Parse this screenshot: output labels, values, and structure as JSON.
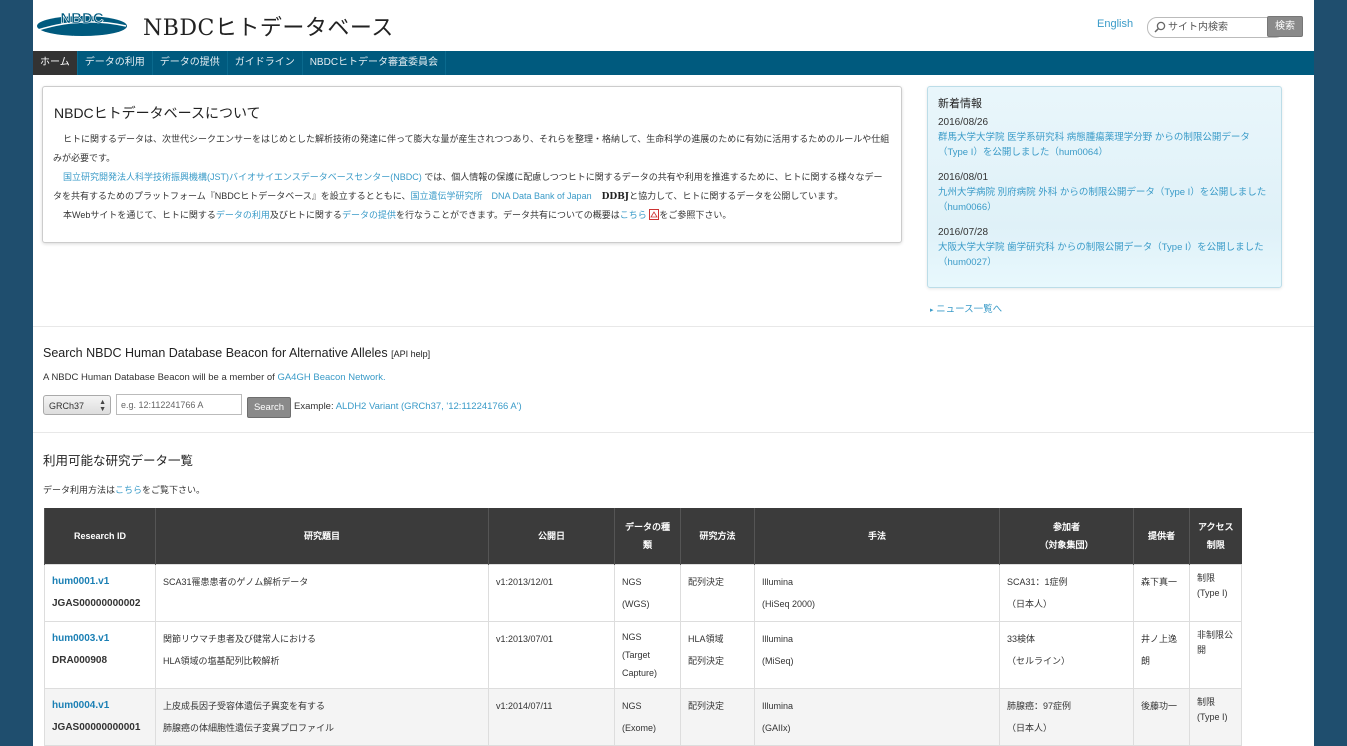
{
  "header": {
    "site_title": "NBDCヒトデータベース",
    "logo_text": "NBDC",
    "logo_subtext": "National Bioscience Database Center",
    "lang_link": "English",
    "search_placeholder": "サイト内検索",
    "search_button": "検索"
  },
  "nav": {
    "items": [
      {
        "label": "ホーム"
      },
      {
        "label": "データの利用"
      },
      {
        "label": "データの提供"
      },
      {
        "label": "ガイドライン"
      },
      {
        "label": "NBDCヒトデータ審査委員会"
      }
    ]
  },
  "about": {
    "title": "NBDCヒトデータベースについて",
    "p1": "ヒトに関するデータは、次世代シークエンサーをはじめとした解析技術の発達に伴って膨大な量が産生されつつあり、それらを整理・格納して、生命科学の進展のために有効に活用するためのルールや仕組みが必要です。",
    "p2_link1": "国立研究開発法人科学技術振興機構(JST)バイオサイエンスデータベースセンター(NBDC)",
    "p2_text1": " では、個人情報の保護に配慮しつつヒトに関するデータの共有や利用を推進するために、ヒトに関する様々なデータを共有するためのプラットフォーム『NBDCヒトデータベース』を設立するとともに、",
    "p2_link2": "国立遺伝学研究所　DNA Data Bank of Japan",
    "p2_ddbj": "DDBJ",
    "p2_text2": "と協力して、ヒトに関するデータを公開しています。",
    "p3_text1": "本Webサイトを通じて、ヒトに関する",
    "p3_link1": "データの利用",
    "p3_text2": "及びヒトに関する",
    "p3_link2": "データの提供",
    "p3_text3": "を行なうことができます。データ共有についての概要は",
    "p3_link3": "こちら",
    "p3_text4": "をご参照下さい。"
  },
  "news": {
    "title": "新着情報",
    "items": [
      {
        "date": "2016/08/26",
        "text": "群馬大学大学院 医学系研究科 病態腫瘍薬理学分野 からの制限公開データ（Type I）を公開しました（hum0064）"
      },
      {
        "date": "2016/08/01",
        "text": "九州大学病院 別府病院 外科 からの制限公開データ（Type I）を公開しました（hum0066）"
      },
      {
        "date": "2016/07/28",
        "text": "大阪大学大学院 歯学研究科 からの制限公開データ（Type I）を公開しました（hum0027）"
      }
    ],
    "more": "ニュース一覧へ"
  },
  "beacon": {
    "title": "Search NBDC Human Database Beacon for Alternative Alleles",
    "api_open": "[",
    "api_help": "API help",
    "api_close": "]",
    "sub_text": "A NBDC Human Database Beacon will be a member of ",
    "sub_link": "GA4GH Beacon Network.",
    "ref_value": "GRCh37",
    "input_placeholder": "e.g. 12:112241766 A",
    "search_button": "Search",
    "example_label": "Example: ",
    "example_link": "ALDH2 Variant (GRCh37, '12:112241766 A')"
  },
  "datasets": {
    "title": "利用可能な研究データ一覧",
    "note_text1": "データ利用方法は",
    "note_link": "こちら",
    "note_text2": "をご覧下さい。",
    "columns": [
      "Research ID",
      "研究題目",
      "公開日",
      "データの種類",
      "研究方法",
      "手法",
      "参加者（対象集団）",
      "提供者",
      "アクセス制限"
    ],
    "col_participants_1": "参加者",
    "col_participants_2": "（対象集団）",
    "col_datatype_1": "データの種",
    "col_datatype_2": "類",
    "col_access_1": "アクセス",
    "col_access_2": "制限",
    "rows": [
      {
        "id": "hum0001.v1",
        "sub_id": "JGAS00000000002",
        "title1": "SCA31罹患患者のゲノム解析データ",
        "title2": "",
        "date": "v1:2013/12/01",
        "type1": "NGS",
        "type2": "(WGS)",
        "type3": "",
        "method1": "配列決定",
        "method2": "",
        "tech1": "Illumina",
        "tech2": "(HiSeq 2000)",
        "part1": "SCA31：1症例",
        "part2": "（日本人）",
        "provider": "森下真一",
        "access1": "制限",
        "access2": "(Type I)"
      },
      {
        "id": "hum0003.v1",
        "sub_id": "DRA000908",
        "title1": "関節リウマチ患者及び健常人における",
        "title2": "HLA領域の塩基配列比較解析",
        "date": "v1:2013/07/01",
        "type1": "NGS",
        "type2": "(Target",
        "type3": "Capture)",
        "method1": "HLA領域",
        "method2": "配列決定",
        "tech1": "Illumina",
        "tech2": "(MiSeq)",
        "part1": "33検体",
        "part2": "（セルライン）",
        "provider": "井ノ上逸朗",
        "access1": "非制限公",
        "access2": "開"
      },
      {
        "id": "hum0004.v1",
        "sub_id": "JGAS00000000001",
        "title1": "上皮成長因子受容体遺伝子異変を有する",
        "title2": "肺腺癌の体細胞性遺伝子変異プロファイル",
        "date": "v1:2014/07/11",
        "type1": "NGS",
        "type2": "(Exome)",
        "type3": "",
        "method1": "配列決定",
        "method2": "",
        "tech1": "Illumina",
        "tech2": "(GAIIx)",
        "part1": "肺腺癌：97症例",
        "part2": "（日本人）",
        "provider": "後藤功一",
        "access1": "制限",
        "access2": "(Type I)"
      }
    ]
  },
  "colors": {
    "background": "#1f4e6e",
    "nav": "#005a7e",
    "link": "#3a9bc8",
    "table_header": "#3b3b3b"
  }
}
